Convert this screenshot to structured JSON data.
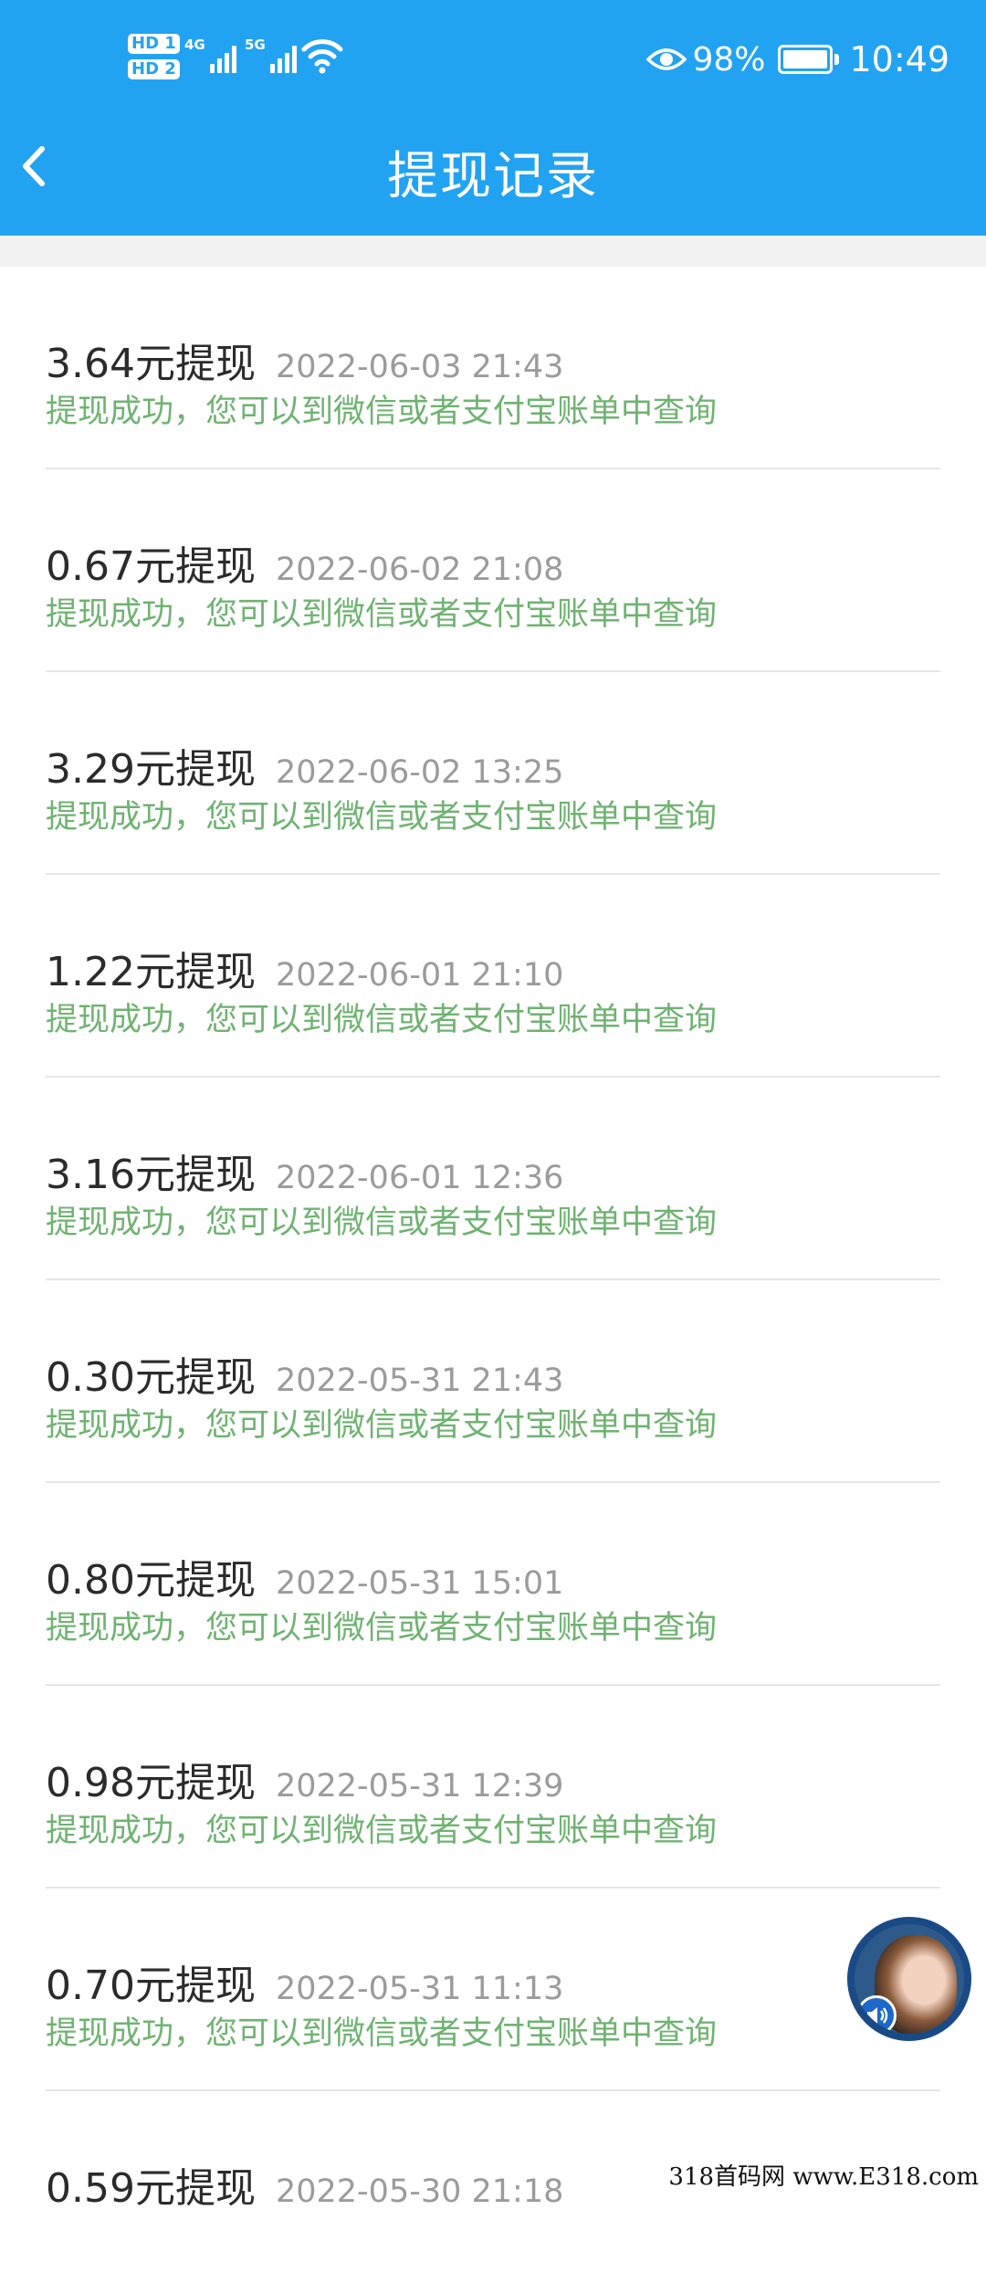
{
  "status_bar": {
    "sim1": "HD 1",
    "sim2": "HD 2",
    "net1": "4G",
    "net2": "5G",
    "battery_pct": "98%",
    "time": "10:49",
    "icons": [
      "hd-sim-icon",
      "signal-4g-icon",
      "signal-5g-icon",
      "wifi-icon",
      "eye-icon",
      "battery-icon"
    ]
  },
  "header": {
    "title": "提现记录",
    "back_icon": "chevron-left-icon",
    "bg_color": "#22A3F2"
  },
  "records": [
    {
      "amount": "3.64元提现",
      "date": "2022-06-03 21:43",
      "status": "提现成功，您可以到微信或者支付宝账单中查询"
    },
    {
      "amount": "0.67元提现",
      "date": "2022-06-02 21:08",
      "status": "提现成功，您可以到微信或者支付宝账单中查询"
    },
    {
      "amount": "3.29元提现",
      "date": "2022-06-02 13:25",
      "status": "提现成功，您可以到微信或者支付宝账单中查询"
    },
    {
      "amount": "1.22元提现",
      "date": "2022-06-01 21:10",
      "status": "提现成功，您可以到微信或者支付宝账单中查询"
    },
    {
      "amount": "3.16元提现",
      "date": "2022-06-01 12:36",
      "status": "提现成功，您可以到微信或者支付宝账单中查询"
    },
    {
      "amount": "0.30元提现",
      "date": "2022-05-31 21:43",
      "status": "提现成功，您可以到微信或者支付宝账单中查询"
    },
    {
      "amount": "0.80元提现",
      "date": "2022-05-31 15:01",
      "status": "提现成功，您可以到微信或者支付宝账单中查询"
    },
    {
      "amount": "0.98元提现",
      "date": "2022-05-31 12:39",
      "status": "提现成功，您可以到微信或者支付宝账单中查询"
    },
    {
      "amount": "0.70元提现",
      "date": "2022-05-31 11:13",
      "status": "提现成功，您可以到微信或者支付宝账单中查询"
    },
    {
      "amount": "0.59元提现",
      "date": "2022-05-30 21:18",
      "status": ""
    }
  ],
  "colors": {
    "status_green": "#6FB371",
    "date_gray": "#9b9b9b"
  },
  "floating_avatar": {
    "icon": "avatar-icon",
    "badge_icon": "speaker-icon"
  },
  "watermark": "318首码网 www.E318.com"
}
